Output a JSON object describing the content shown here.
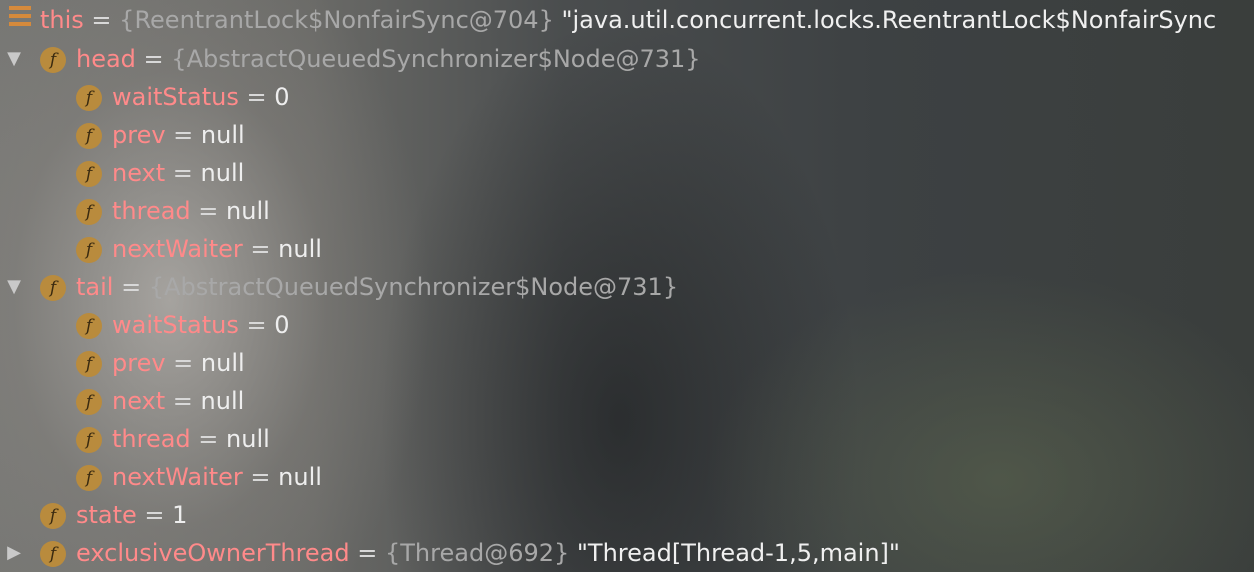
{
  "tree": {
    "root": {
      "name": "this",
      "eq": " = ",
      "type": "{ReentrantLock$NonfairSync@704}",
      "value": " \"java.util.concurrent.locks.ReentrantLock$NonfairSync"
    },
    "head": {
      "name": "head",
      "eq": " = ",
      "type": "{AbstractQueuedSynchronizer$Node@731}",
      "children": [
        {
          "name": "waitStatus",
          "eq": " = ",
          "value": "0"
        },
        {
          "name": "prev",
          "eq": " = ",
          "value": "null"
        },
        {
          "name": "next",
          "eq": " = ",
          "value": "null"
        },
        {
          "name": "thread",
          "eq": " = ",
          "value": "null"
        },
        {
          "name": "nextWaiter",
          "eq": " = ",
          "value": "null"
        }
      ]
    },
    "tail": {
      "name": "tail",
      "eq": " = ",
      "type": "{AbstractQueuedSynchronizer$Node@731}",
      "children": [
        {
          "name": "waitStatus",
          "eq": " = ",
          "value": "0"
        },
        {
          "name": "prev",
          "eq": " = ",
          "value": "null"
        },
        {
          "name": "next",
          "eq": " = ",
          "value": "null"
        },
        {
          "name": "thread",
          "eq": " = ",
          "value": "null"
        },
        {
          "name": "nextWaiter",
          "eq": " = ",
          "value": "null"
        }
      ]
    },
    "state": {
      "name": "state",
      "eq": " = ",
      "value": "1"
    },
    "owner": {
      "name": "exclusiveOwnerThread",
      "eq": " = ",
      "type": "{Thread@692}",
      "value": " \"Thread[Thread-1,5,main]\""
    },
    "field_icon_glyph": "f",
    "expanded_arrow": "▼",
    "collapsed_arrow": "▶"
  }
}
